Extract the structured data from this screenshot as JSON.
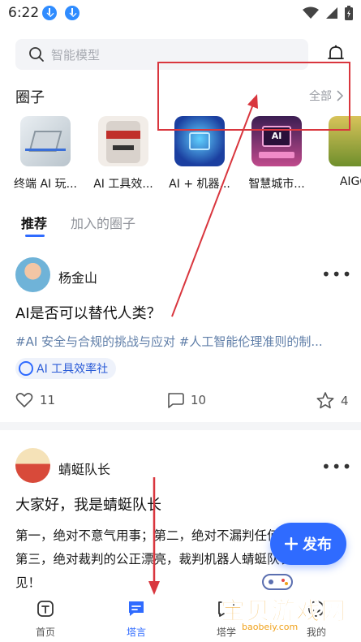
{
  "status_bar": {
    "time": "6:22"
  },
  "search": {
    "placeholder": "智能模型"
  },
  "circles": {
    "title": "圈子",
    "all_label": "全部",
    "items": [
      {
        "label": "终端 AI 玩..."
      },
      {
        "label": "AI 工具效..."
      },
      {
        "label": "AI + 机器..."
      },
      {
        "label": "智慧城市..."
      },
      {
        "label": "AIGC"
      }
    ]
  },
  "tabs": [
    {
      "label": "推荐",
      "active": true
    },
    {
      "label": "加入的圈子",
      "active": false
    }
  ],
  "posts": [
    {
      "author": "杨金山",
      "title": "AI是否可以替代人类？",
      "tags": "#AI 安全与合规的挑战与应对 #人工智能伦理准则的制...",
      "circle_chip": "AI 工具效率社",
      "likes": "11",
      "comments": "10",
      "stars": "4"
    },
    {
      "author": "蜻蜓队长",
      "title": "大家好，我是蜻蜓队长",
      "body": "第一，绝对不意气用事；第二，绝对不漏判任何一件坏事；第三，绝对裁判的公正漂亮，裁判机器人蜻蜓队长前来觐见！"
    }
  ],
  "fab": {
    "label": "发布"
  },
  "nav": [
    {
      "label": "首页"
    },
    {
      "label": "塔言"
    },
    {
      "label": "塔学"
    },
    {
      "label": "我的"
    }
  ],
  "watermark": {
    "text": "宝贝游戏网",
    "url": "baobeiy.com"
  },
  "colors": {
    "accent": "#2f6bff",
    "annotation": "#d9363e",
    "watermark": "#f0a21c"
  }
}
